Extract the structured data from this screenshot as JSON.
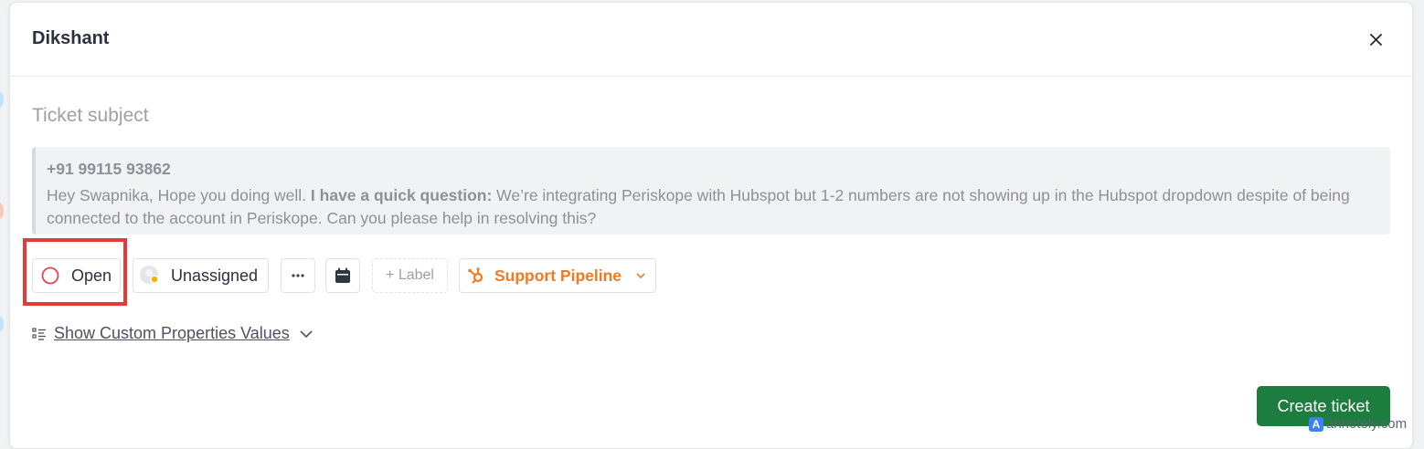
{
  "modal": {
    "title": "Dikshant",
    "subject_placeholder": "Ticket subject"
  },
  "message": {
    "phone": "+91 99115 93862",
    "text_before": "Hey Swapnika, Hope you doing well. ",
    "text_bold": "I have a quick question:",
    "text_after": " We’re integrating Periskope with Hubspot but 1-2 numbers are not showing up in the Hubspot dropdown despite of being connected to the account in Periskope. Can you please help in resolving this?"
  },
  "toolbar": {
    "status_label": "Open",
    "assignee_label": "Unassigned",
    "label_button": "+ Label",
    "pipeline_label": "Support Pipeline"
  },
  "custom_properties": {
    "toggle_label": "Show Custom Properties Values"
  },
  "footer": {
    "create_label": "Create ticket"
  },
  "watermark": {
    "logo": "A",
    "text": "annotely.com"
  },
  "colors": {
    "primary_button": "#1c7d3e",
    "status_ring": "#e0464b",
    "pipeline_accent": "#f07a22",
    "highlight": "#e23b3b"
  },
  "icons": [
    "close-icon",
    "status-circle-icon",
    "avatar-icon",
    "more-icon",
    "calendar-icon",
    "hubspot-icon",
    "chevron-down-icon",
    "list-icon"
  ]
}
